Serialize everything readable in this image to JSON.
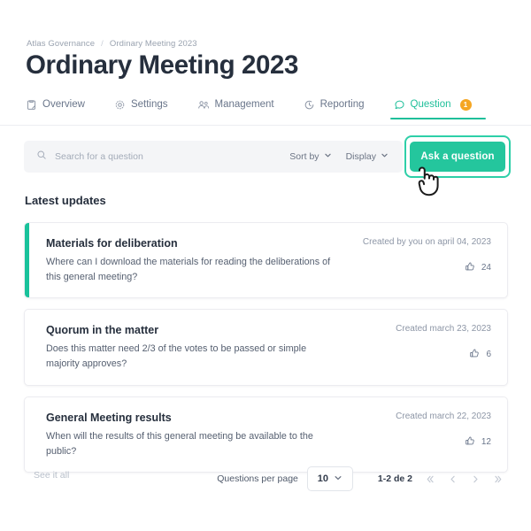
{
  "breadcrumb": {
    "root": "Atlas Governance",
    "separator": "/",
    "current": "Ordinary Meeting 2023"
  },
  "page_title": "Ordinary Meeting 2023",
  "tabs": [
    {
      "label": "Overview",
      "icon": "clipboard-icon",
      "active": false,
      "badge": null
    },
    {
      "label": "Settings",
      "icon": "gear-icon",
      "active": false,
      "badge": null
    },
    {
      "label": "Management",
      "icon": "people-icon",
      "active": false,
      "badge": null
    },
    {
      "label": "Reporting",
      "icon": "clock-icon",
      "active": false,
      "badge": null
    },
    {
      "label": "Question",
      "icon": "chat-icon",
      "active": true,
      "badge": "1"
    }
  ],
  "toolbar": {
    "search_placeholder": "Search for a question",
    "search_value": "",
    "sort_label": "Sort by",
    "display_label": "Display",
    "ask_button": "Ask a question"
  },
  "section": {
    "title": "Latest updates"
  },
  "questions": [
    {
      "title": "Materials for deliberation",
      "body": "Where can I download the materials for reading the deliberations of this general meeting?",
      "date": "Created by you on april 04, 2023",
      "likes": "24",
      "accent": true
    },
    {
      "title": "Quorum in the matter",
      "body": "Does this matter need 2/3 of the votes to be passed or simple majority approves?",
      "date": "Created march 23, 2023",
      "likes": "6",
      "accent": false
    },
    {
      "title": "General Meeting results",
      "body": "When will the results of this general meeting be available to the public?",
      "date": "Created march 22, 2023",
      "likes": "12",
      "accent": false
    }
  ],
  "footer": {
    "see_all": "See it all",
    "per_page_label": "Questions per page",
    "per_page_value": "10",
    "range": "1-2 de 2"
  },
  "colors": {
    "accent": "#19c29b",
    "button": "#24c69d",
    "badge": "#f5a623",
    "text_dark": "#262f3d",
    "text_muted": "#8d96a6",
    "toolbar_bg": "#f4f5f7"
  }
}
